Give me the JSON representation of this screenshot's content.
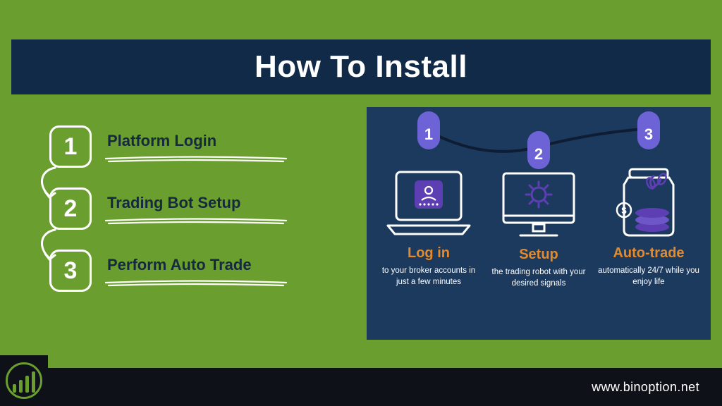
{
  "title": "How To Install",
  "steps": [
    {
      "num": "1",
      "label": "Platform Login"
    },
    {
      "num": "2",
      "label": "Trading Bot Setup"
    },
    {
      "num": "3",
      "label": "Perform Auto Trade"
    }
  ],
  "panel": {
    "cols": [
      {
        "num": "1",
        "title": "Log in",
        "desc": "to your broker accounts in just a few minutes"
      },
      {
        "num": "2",
        "title": "Setup",
        "desc": "the trading robot with your desired signals"
      },
      {
        "num": "3",
        "title": "Auto-trade",
        "desc": "automatically 24/7 while you enjoy life"
      }
    ]
  },
  "footer": {
    "url": "www.binoption.net"
  }
}
